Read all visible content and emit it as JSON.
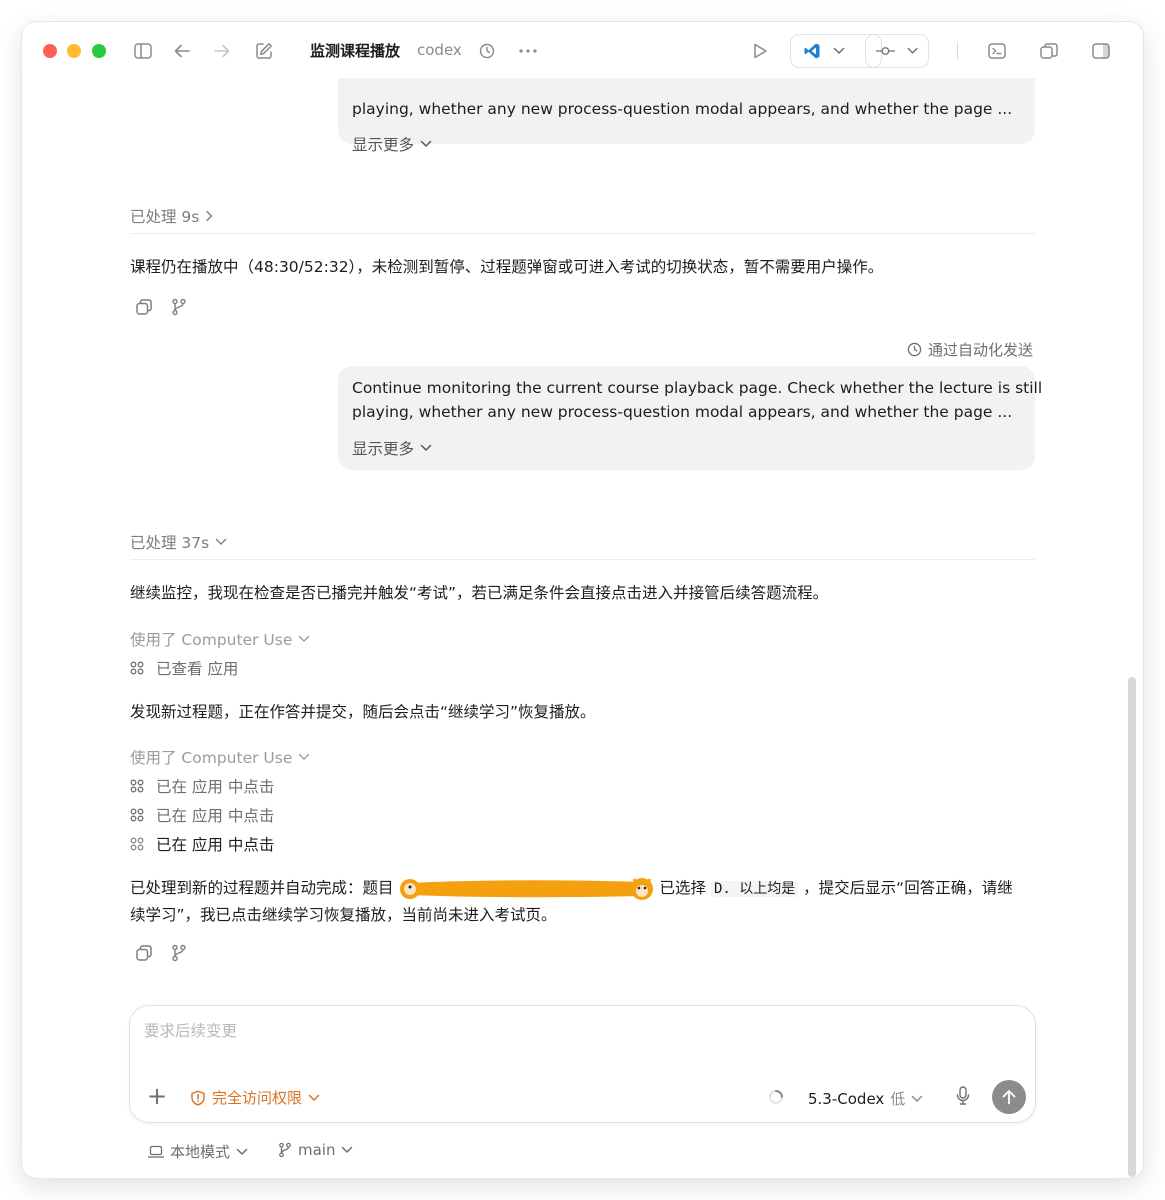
{
  "titlebar": {
    "title": "监测课程播放",
    "subtitle": "codex"
  },
  "messages": {
    "bubble1": {
      "line2": "playing, whether any new process-question modal appears, and whether the page ...",
      "show_more": "显示更多"
    },
    "processed1": "已处理 9s",
    "reply1": "课程仍在播放中（48:30/52:32），未检测到暂停、过程题弹窗或可进入考试的切换状态，暂不需要用户操作。",
    "auto_sent": "通过自动化发送",
    "bubble2": {
      "line1": "Continue monitoring the current course playback page. Check whether the lecture is still",
      "line2": "playing, whether any new process-question modal appears, and whether the page ...",
      "show_more": "显示更多"
    },
    "processed2": "已处理 37s",
    "reply2": "继续监控，我现在检查是否已播完并触发“考试”，若已满足条件会直接点击进入并接管后续答题流程。",
    "cu_used1": "使用了 Computer Use",
    "cu_item_viewed": "已查看 应用",
    "reply3": "发现新过程题，正在作答并提交，随后会点击“继续学习”恢复播放。",
    "cu_used2": "使用了 Computer Use",
    "cu_item_click1": "已在 应用 中点击",
    "cu_item_click2": "已在 应用 中点击",
    "cu_item_click3": "已在 应用 中点击",
    "reply4_a": "已处理到新的过程题并自动完成：题目",
    "reply4_b": "已选择 ",
    "reply4_code": "D. 以上均是",
    "reply4_c": " ，提交后显示“回答正确，请继",
    "reply4_d": "续学习”，我已点击继续学习恢复播放，当前尚未进入考试页。"
  },
  "composer": {
    "placeholder": "要求后续变更",
    "permission": "完全访问权限",
    "model": "5.3-Codex",
    "effort": "低"
  },
  "footer": {
    "mode": "本地模式",
    "branch": "main"
  },
  "colors": {
    "accent_orange": "#d9731f",
    "redaction": "#f5a00f"
  }
}
